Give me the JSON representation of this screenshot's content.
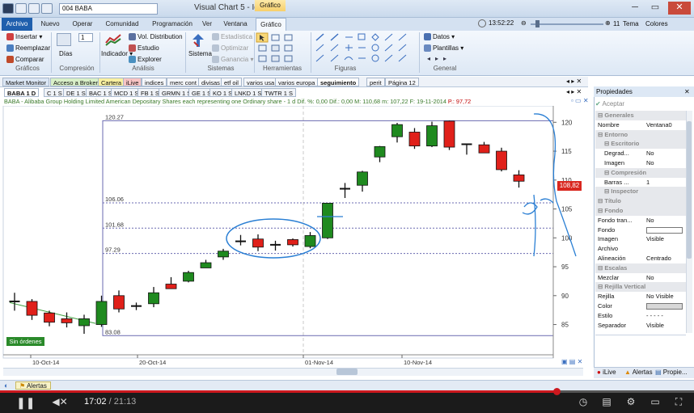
{
  "window": {
    "title": "Visual Chart 5 - Igl",
    "symbol": "004 BABA",
    "context_tab": "Gráfico"
  },
  "ribbon_tabs": [
    "Archivo",
    "Nuevo",
    "Operar",
    "Comunidad",
    "Programación",
    "Ver",
    "Ventana",
    "Gráfico"
  ],
  "status": {
    "time": "13:52:22",
    "zoom": "11",
    "tema": "Tema",
    "colores": "Colores"
  },
  "ribbon": {
    "graficos": {
      "insertar": "Insertar",
      "reemplazar": "Reemplazar",
      "comparar": "Comparar",
      "group": "Gráficos"
    },
    "compresion": {
      "dias": "Días",
      "value": "1",
      "group": "Compresión"
    },
    "analisis": {
      "indicador": "Indicador",
      "vol": "Vol. Distribution",
      "estudio": "Estudio",
      "explorer": "Explorer",
      "group": "Análisis"
    },
    "sistemas": {
      "sistema": "Sistema",
      "estadistica": "Estadística",
      "optimizar": "Optimizar",
      "ganancia": "Ganancia",
      "group": "Sistemas"
    },
    "herramientas": {
      "group": "Herramientas"
    },
    "figuras": {
      "group": "Figuras"
    },
    "general": {
      "datos": "Datos",
      "plantillas": "Plantillas",
      "group": "General"
    }
  },
  "top_tabs": [
    "Market Monitor",
    "Acceso a Broker",
    "Cartera",
    "iLive",
    "indices",
    "merc cont",
    "divisas",
    "etf oil",
    "varios usa",
    "varios europa",
    "seguimiento",
    "perit",
    "Página 12"
  ],
  "sub_tabs": [
    "BABA 1 D",
    "C 1 S",
    "DE 1 S",
    "BAC 1 S",
    "MCD 1 S",
    "FB 1 S",
    "GRMN 1 S",
    "GE 1 S",
    "KO 1 S",
    "LNKD 1 S",
    "TWTR 1 S"
  ],
  "info_line": {
    "text": "BABA - Alibaba Group Holding Limited American Depositary Shares each representing one Ordinary share -  1 d  Dif. %: 0,00  Dif.: 0,00  M: 110,68  m: 107,22  F: 19-11-2014",
    "p": "P.: 97,72"
  },
  "chart_data": {
    "type": "candlestick",
    "x_labels": [
      "10-Oct-14",
      "20-Oct-14",
      "01-Nov-14",
      "10-Nov-14"
    ],
    "y_ticks": [
      85,
      90,
      95,
      100,
      105,
      110,
      115,
      120
    ],
    "ylim": [
      82,
      122
    ],
    "last_price": "108,82",
    "levels": [
      {
        "label": "120.27",
        "value": 120.27
      },
      {
        "label": "106.06",
        "value": 106.06
      },
      {
        "label": "101.68",
        "value": 101.68
      },
      {
        "label": "97.29",
        "value": 97.29
      },
      {
        "label": "83.08",
        "value": 83.08
      }
    ],
    "candles": [
      {
        "o": 89.0,
        "h": 90.5,
        "l": 87.4,
        "c": 89.0
      },
      {
        "o": 89.0,
        "h": 89.4,
        "l": 85.8,
        "c": 86.6
      },
      {
        "o": 87.0,
        "h": 87.4,
        "l": 84.7,
        "c": 85.4
      },
      {
        "o": 86.0,
        "h": 87.1,
        "l": 84.5,
        "c": 85.3
      },
      {
        "o": 84.8,
        "h": 86.7,
        "l": 83.4,
        "c": 86.0
      },
      {
        "o": 85.0,
        "h": 90.0,
        "l": 84.6,
        "c": 89.0
      },
      {
        "o": 90.0,
        "h": 90.9,
        "l": 87.1,
        "c": 87.7
      },
      {
        "o": 88.2,
        "h": 88.8,
        "l": 87.5,
        "c": 88.2
      },
      {
        "o": 88.6,
        "h": 91.5,
        "l": 88.0,
        "c": 90.5
      },
      {
        "o": 92.0,
        "h": 93.2,
        "l": 91.2,
        "c": 91.2
      },
      {
        "o": 92.5,
        "h": 94.3,
        "l": 92.3,
        "c": 94.0
      },
      {
        "o": 94.8,
        "h": 96.2,
        "l": 94.8,
        "c": 95.7
      },
      {
        "o": 96.7,
        "h": 98.1,
        "l": 96.2,
        "c": 97.7
      },
      {
        "o": 99.4,
        "h": 100.5,
        "l": 98.7,
        "c": 99.4
      },
      {
        "o": 99.8,
        "h": 100.6,
        "l": 97.7,
        "c": 98.4
      },
      {
        "o": 98.8,
        "h": 99.5,
        "l": 97.8,
        "c": 98.8
      },
      {
        "o": 99.7,
        "h": 99.9,
        "l": 98.5,
        "c": 98.8
      },
      {
        "o": 98.5,
        "h": 101.0,
        "l": 98.2,
        "c": 100.4
      },
      {
        "o": 100.0,
        "h": 106.0,
        "l": 99.8,
        "c": 106.0
      },
      {
        "o": 108.5,
        "h": 109.5,
        "l": 106.9,
        "c": 108.5
      },
      {
        "o": 109.1,
        "h": 111.6,
        "l": 108.0,
        "c": 111.4
      },
      {
        "o": 114.0,
        "h": 115.9,
        "l": 113.1,
        "c": 115.8
      },
      {
        "o": 117.5,
        "h": 119.9,
        "l": 116.5,
        "c": 119.6
      },
      {
        "o": 118.3,
        "h": 119.0,
        "l": 115.4,
        "c": 115.9
      },
      {
        "o": 115.9,
        "h": 120.1,
        "l": 115.7,
        "c": 119.4
      },
      {
        "o": 120.2,
        "h": 120.3,
        "l": 115.2,
        "c": 115.7
      },
      {
        "o": 116.2,
        "h": 116.2,
        "l": 114.4,
        "c": 116.2
      },
      {
        "o": 116.1,
        "h": 116.6,
        "l": 114.7,
        "c": 114.7
      },
      {
        "o": 115.0,
        "h": 115.6,
        "l": 111.5,
        "c": 111.8
      },
      {
        "o": 110.9,
        "h": 111.7,
        "l": 108.7,
        "c": 109.8
      }
    ],
    "badge": "Sin órdenes"
  },
  "properties": {
    "title": "Propiedades",
    "accept": "Aceptar",
    "rows": [
      {
        "k": "Generales",
        "sec": true,
        "lvl": 0
      },
      {
        "k": "Nombre",
        "v": "Ventana0",
        "lvl": 0
      },
      {
        "k": "Entorno",
        "sec": true,
        "lvl": 0
      },
      {
        "k": "Escritorio",
        "sec": true,
        "lvl": 1
      },
      {
        "k": "Degrad...",
        "v": "No",
        "lvl": 1
      },
      {
        "k": "Imagen",
        "v": "No",
        "lvl": 1
      },
      {
        "k": "Compresión",
        "sec": true,
        "lvl": 1
      },
      {
        "k": "Barras ...",
        "v": "1",
        "lvl": 1
      },
      {
        "k": "Inspector",
        "sec": true,
        "lvl": 1
      },
      {
        "k": "Título",
        "sec": true,
        "lvl": 0
      },
      {
        "k": "Fondo",
        "sec": true,
        "lvl": 0
      },
      {
        "k": "Fondo tran...",
        "v": "No",
        "lvl": 0
      },
      {
        "k": "Fondo",
        "v": "",
        "swatch": "#ffffff",
        "lvl": 0
      },
      {
        "k": "Imagen",
        "v": "Visible",
        "lvl": 0
      },
      {
        "k": "Archivo",
        "v": "",
        "lvl": 0
      },
      {
        "k": "Alineación",
        "v": "Centrado",
        "lvl": 0
      },
      {
        "k": "Escalas",
        "sec": true,
        "lvl": 0
      },
      {
        "k": "Mezclar",
        "v": "No",
        "lvl": 0
      },
      {
        "k": "Rejilla Vertical",
        "sec": true,
        "lvl": 0
      },
      {
        "k": "Rejilla",
        "v": "No Visible",
        "lvl": 0
      },
      {
        "k": "Color",
        "v": "",
        "swatch": "#d8d8d8",
        "lvl": 0
      },
      {
        "k": "Estilo",
        "v": "- - - - -",
        "lvl": 0
      },
      {
        "k": "Separador",
        "v": "Visible",
        "lvl": 0
      }
    ],
    "footer": {
      "ilive": "iLive",
      "alertas": "Alertas",
      "propie": "Propie..."
    }
  },
  "bottom": {
    "alertas": "Alertas"
  },
  "player": {
    "current": "17:02",
    "total": "/ 21:13",
    "progress": 0.802
  }
}
